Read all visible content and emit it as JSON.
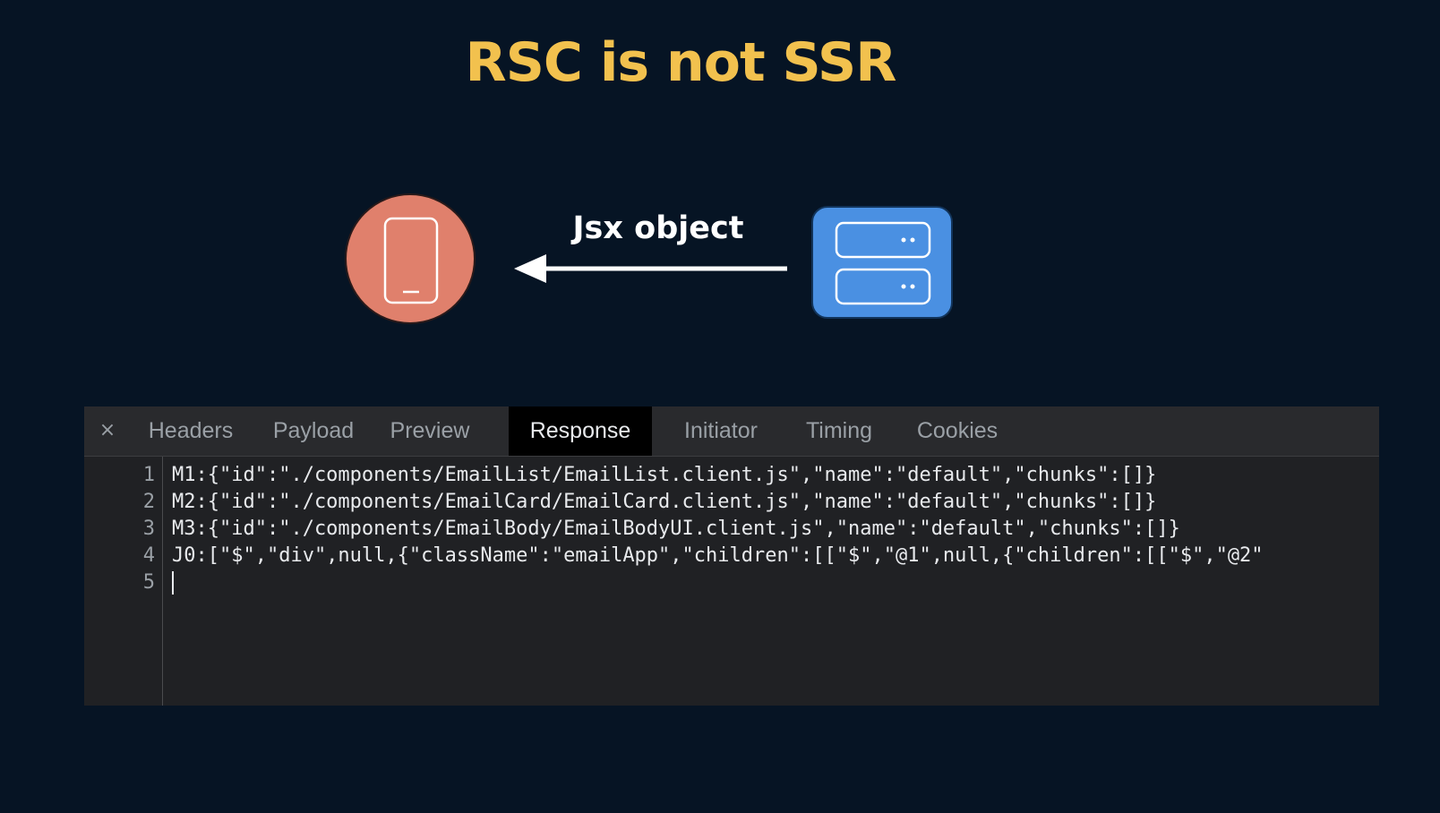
{
  "slide": {
    "title": "RSC is not SSR"
  },
  "diagram": {
    "client_icon": "mobile-phone-icon",
    "server_icon": "server-icon",
    "arrow_label": "Jsx object",
    "colors": {
      "client_circle": "#e0806c",
      "server_box": "#4a90e2",
      "title": "#f2c14e",
      "background": "#061424"
    }
  },
  "devtools": {
    "close_label": "×",
    "tabs": [
      {
        "label": "Headers",
        "active": false
      },
      {
        "label": "Payload",
        "active": false
      },
      {
        "label": "Preview",
        "active": false
      },
      {
        "label": "Response",
        "active": true
      },
      {
        "label": "Initiator",
        "active": false
      },
      {
        "label": "Timing",
        "active": false
      },
      {
        "label": "Cookies",
        "active": false
      }
    ],
    "lines": [
      {
        "number": "1",
        "text": "M1:{\"id\":\"./components/EmailList/EmailList.client.js\",\"name\":\"default\",\"chunks\":[]}"
      },
      {
        "number": "2",
        "text": "M2:{\"id\":\"./components/EmailCard/EmailCard.client.js\",\"name\":\"default\",\"chunks\":[]}"
      },
      {
        "number": "3",
        "text": "M3:{\"id\":\"./components/EmailBody/EmailBodyUI.client.js\",\"name\":\"default\",\"chunks\":[]}"
      },
      {
        "number": "4",
        "text": "J0:[\"$\",\"div\",null,{\"className\":\"emailApp\",\"children\":[[\"$\",\"@1\",null,{\"children\":[[\"$\",\"@2\""
      },
      {
        "number": "5",
        "text": ""
      }
    ]
  }
}
